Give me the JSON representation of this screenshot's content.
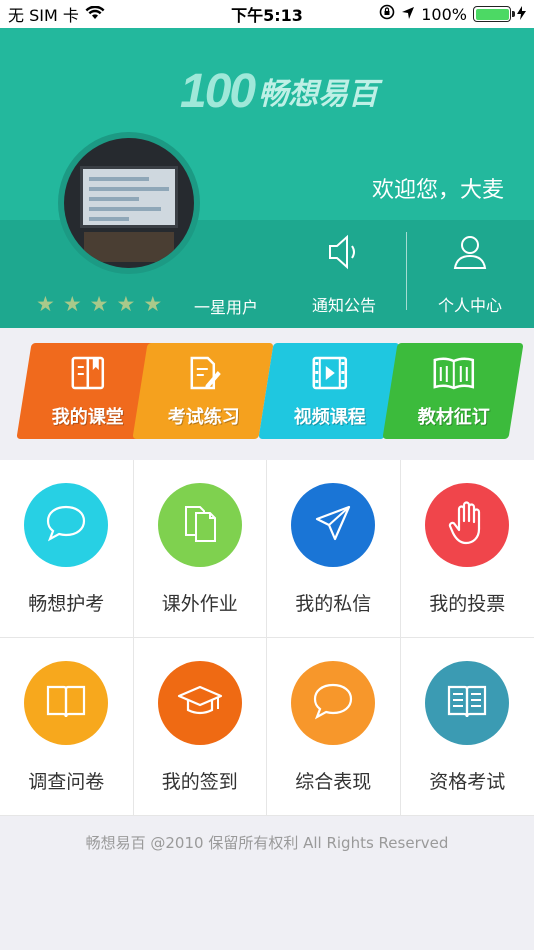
{
  "status_bar": {
    "carrier": "无 SIM 卡",
    "time": "下午5:13",
    "battery_percent": "100%",
    "battery_level": 1.0,
    "battery_color": "#4cd964"
  },
  "header": {
    "logo_number": "100",
    "logo_text": "畅想易百",
    "welcome": "欢迎您，大麦",
    "rating_stars": 5,
    "user_level": "一星用户",
    "notice_label": "通知公告",
    "notice_icon": "speaker-icon",
    "profile_label": "个人中心",
    "profile_icon": "person-icon",
    "bg_color": "#23b89d"
  },
  "categories": [
    {
      "label": "我的课堂",
      "icon": "book-bookmark-icon",
      "color": "#f06a1d"
    },
    {
      "label": "考试练习",
      "icon": "exam-pencil-icon",
      "color": "#f5a11e"
    },
    {
      "label": "视频课程",
      "icon": "film-icon",
      "color": "#1fc7e0"
    },
    {
      "label": "教材征订",
      "icon": "open-book-icon",
      "color": "#3cbb3c"
    }
  ],
  "grid": [
    {
      "label": "畅想护考",
      "icon": "chat-bubble-icon",
      "color": "#27d0e4"
    },
    {
      "label": "课外作业",
      "icon": "documents-icon",
      "color": "#7fd14f"
    },
    {
      "label": "我的私信",
      "icon": "paper-plane-icon",
      "color": "#1a75d6"
    },
    {
      "label": "我的投票",
      "icon": "hand-icon",
      "color": "#f0454b"
    },
    {
      "label": "调查问卷",
      "icon": "book-icon",
      "color": "#f7a81d"
    },
    {
      "label": "我的签到",
      "icon": "graduation-cap-icon",
      "color": "#ef6a13"
    },
    {
      "label": "综合表现",
      "icon": "chat-bubble-icon",
      "color": "#f7972b"
    },
    {
      "label": "资格考试",
      "icon": "book-lines-icon",
      "color": "#3b9bb3"
    }
  ],
  "footer": "畅想易百 @2010 保留所有权利 All Rights Reserved"
}
